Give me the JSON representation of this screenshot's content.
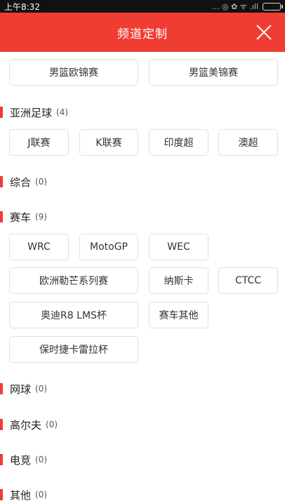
{
  "status_bar": {
    "time": "上午8:32",
    "icons": "... ◎ ✿ ᯤ .ıll"
  },
  "header": {
    "title": "频道定制"
  },
  "top_chips": [
    "男篮欧锦赛",
    "男篮美锦赛"
  ],
  "sections": [
    {
      "name": "亚洲足球",
      "count": "(4)",
      "chips": [
        "J联赛",
        "K联赛",
        "印度超",
        "澳超"
      ]
    },
    {
      "name": "综合",
      "count": "(0)",
      "chips": []
    },
    {
      "name": "赛车",
      "count": "(9)",
      "chips": [
        "WRC",
        "MotoGP",
        "WEC",
        "欧洲勒芒系列赛",
        "纳斯卡",
        "CTCC",
        "奥迪R8 LMS杯",
        "赛车其他",
        "保时捷卡雷拉杯"
      ]
    },
    {
      "name": "网球",
      "count": "(0)",
      "chips": []
    },
    {
      "name": "高尔夫",
      "count": "(0)",
      "chips": []
    },
    {
      "name": "电竞",
      "count": "(0)",
      "chips": []
    },
    {
      "name": "其他",
      "count": "(0)",
      "chips": []
    }
  ],
  "colors": {
    "accent": "#ef3d34",
    "chip_border": "#e1e1e1"
  }
}
